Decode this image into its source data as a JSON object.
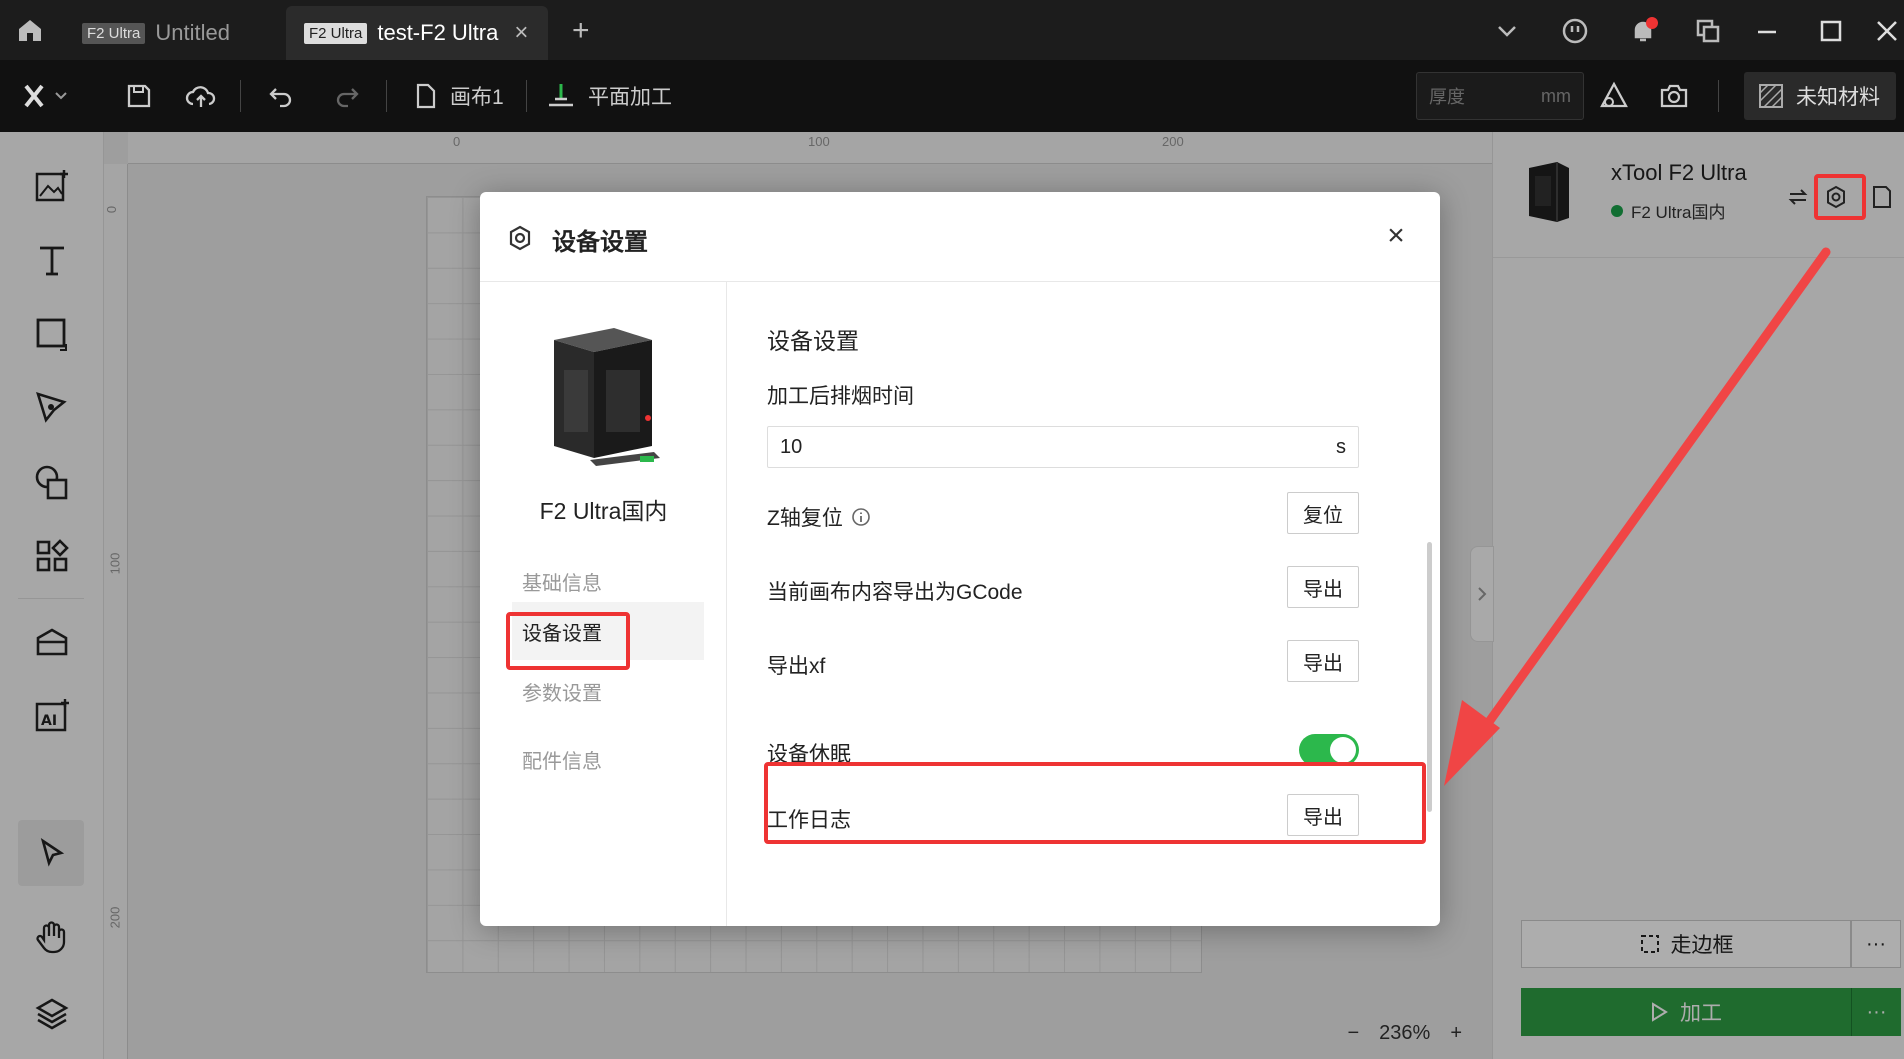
{
  "titlebar": {
    "tabs": [
      {
        "tag": "F2 Ultra",
        "name": "Untitled"
      },
      {
        "tag": "F2 Ultra",
        "name": "test-F2 Ultra",
        "close": "×"
      }
    ],
    "new_tab": "+"
  },
  "toolbar": {
    "canvas_label": "画布1",
    "mode_label": "平面加工",
    "thickness_placeholder": "厚度",
    "thickness_unit": "mm",
    "material_label": "未知材料"
  },
  "canvas": {
    "ruler_top": [
      "0",
      "100",
      "200"
    ],
    "ruler_left": [
      "0",
      "100",
      "200"
    ],
    "zoom": "236%",
    "zoom_out": "−",
    "zoom_in": "+"
  },
  "right_panel": {
    "device_name": "xTool F2 Ultra",
    "device_status": "F2 Ultra国内",
    "frame_button": "走边框",
    "run_button": "加工",
    "more": "···"
  },
  "dialog": {
    "title": "设备设置",
    "close": "×",
    "device_name": "F2 Ultra国内",
    "nav": [
      "基础信息",
      "设备设置",
      "参数设置",
      "配件信息"
    ],
    "selected_nav": 1,
    "section_title": "设备设置",
    "exhaust_label": "加工后排烟时间",
    "exhaust_value": "10",
    "exhaust_unit": "s",
    "z_axis_label": "Z轴复位",
    "z_axis_button": "复位",
    "gcode_label": "当前画布内容导出为GCode",
    "gcode_button": "导出",
    "xf_label": "导出xf",
    "xf_button": "导出",
    "sleep_label": "设备休眠",
    "sleep_on": true,
    "log_label": "工作日志",
    "log_button": "导出"
  },
  "colors": {
    "highlight": "#e33333",
    "accent_green": "#2f9e44",
    "arrow": "#f04545"
  }
}
